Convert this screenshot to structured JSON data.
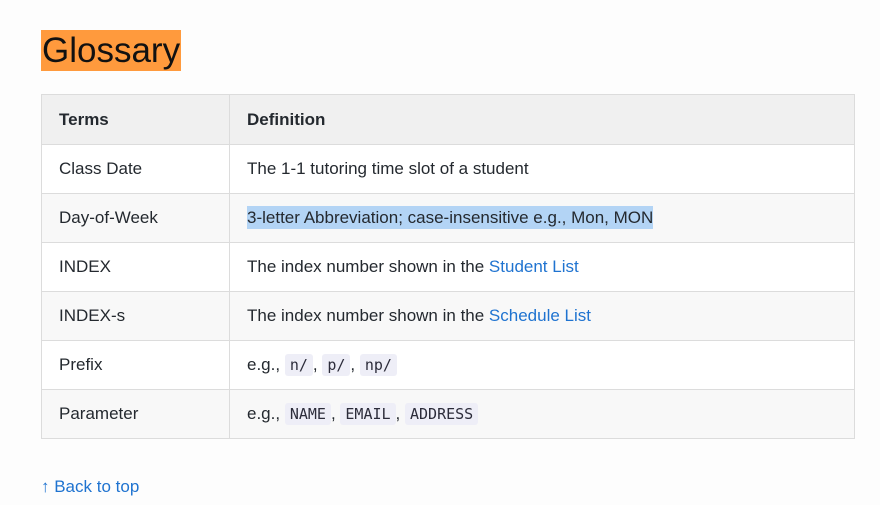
{
  "heading": "Glossary",
  "table": {
    "headers": [
      "Terms",
      "Definition"
    ],
    "rows": [
      {
        "term": "Class Date",
        "definition": "The 1-1 tutoring time slot of a student"
      },
      {
        "term": "Day-of-Week",
        "definition": "3-letter Abbreviation; case-insensitive e.g., Mon, MON"
      },
      {
        "term": "INDEX",
        "definition_prefix": "The index number shown in the ",
        "link": "Student List"
      },
      {
        "term": "INDEX-s",
        "definition_prefix": "The index number shown in the ",
        "link": "Schedule List"
      },
      {
        "term": "Prefix",
        "definition_prefix": "e.g., ",
        "codes": [
          "n/",
          "p/",
          "np/"
        ],
        "separator": ", "
      },
      {
        "term": "Parameter",
        "definition_prefix": "e.g., ",
        "codes": [
          "NAME",
          "EMAIL",
          "ADDRESS"
        ],
        "separator": ", "
      }
    ]
  },
  "back_to_top": "↑ Back to top",
  "colors": {
    "heading_highlight": "#ff9a3d",
    "link": "#1f73d0",
    "selection": "#b3d4f5"
  }
}
